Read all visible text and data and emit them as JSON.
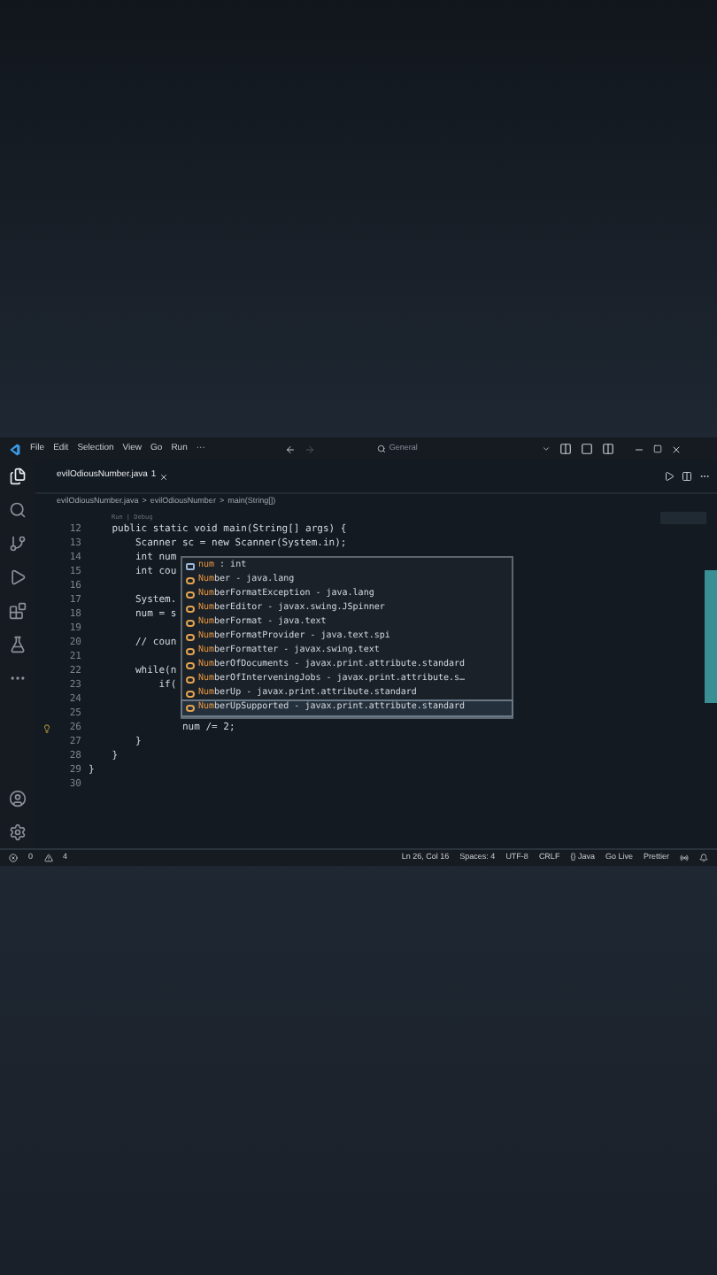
{
  "title_bar": {
    "menu": [
      "File",
      "Edit",
      "Selection",
      "View",
      "Go",
      "Run",
      "···"
    ],
    "search": {
      "placeholder": "General"
    }
  },
  "tabs": [
    {
      "label": "evilOdiousNumber.java",
      "badge": "1",
      "selected": true
    }
  ],
  "breadcrumb": [
    "evilOdiousNumber.java",
    ">",
    "evilOdiousNumber",
    ">",
    "main(String[])"
  ],
  "activity_bar": [
    {
      "kind": "files",
      "selected": true
    },
    {
      "kind": "search",
      "selected": false
    },
    {
      "kind": "source-control",
      "selected": false
    },
    {
      "kind": "run",
      "selected": false
    },
    {
      "kind": "extensions",
      "selected": false
    },
    {
      "kind": "testing",
      "selected": false
    },
    {
      "kind": "more",
      "selected": false
    }
  ],
  "code_lens": "Run | Debug",
  "code_lines": [
    {
      "number": "12",
      "text": "    public static void main(String[] args) {"
    },
    {
      "number": "13",
      "text": "        Scanner sc = new Scanner(System.in);"
    },
    {
      "number": "14",
      "text": "        int num"
    },
    {
      "number": "15",
      "text": "        int cou"
    },
    {
      "number": "16"
    },
    {
      "number": "17",
      "text": "        System."
    },
    {
      "number": "18",
      "text": "        num = s"
    },
    {
      "number": "19"
    },
    {
      "number": "20",
      "text": "        // coun"
    },
    {
      "number": "21"
    },
    {
      "number": "22",
      "text": "        while(n"
    },
    {
      "number": "23",
      "text": "            if("
    },
    {
      "number": "24"
    },
    {
      "number": "25"
    },
    {
      "number": "26",
      "text": "                num /= 2;",
      "lightbulb": true
    },
    {
      "number": "27",
      "text": "        }"
    },
    {
      "number": "28",
      "text": "    }"
    },
    {
      "number": "29",
      "text": "}"
    },
    {
      "number": "30"
    }
  ],
  "suggestions": [
    {
      "kind": "variable",
      "label": "**num** : int",
      "selected": false
    },
    {
      "kind": "class",
      "label": "**Num**ber - java.lang",
      "selected": false
    },
    {
      "kind": "class",
      "label": "**Num**berFormatException - java.lang",
      "selected": false
    },
    {
      "kind": "class",
      "label": "**Num**berEditor - javax.swing.JSpinner",
      "selected": false
    },
    {
      "kind": "class",
      "label": "**Num**berFormat - java.text",
      "selected": false
    },
    {
      "kind": "class",
      "label": "**Num**berFormatProvider - java.text.spi",
      "selected": false
    },
    {
      "kind": "class",
      "label": "**Num**berFormatter - javax.swing.text",
      "selected": false
    },
    {
      "kind": "class",
      "label": "**Num**berOfDocuments - javax.print.attribute.standard",
      "selected": false
    },
    {
      "kind": "class",
      "label": "**Num**berOfInterveningJobs - javax.print.attribute.s…",
      "selected": false
    },
    {
      "kind": "class",
      "label": "**Num**berUp - javax.print.attribute.standard",
      "selected": false
    },
    {
      "kind": "class",
      "label": "**Num**berUpSupported - javax.print.attribute.standard",
      "selected": true
    }
  ],
  "status_bar": {
    "errors": "0",
    "warnings": "4",
    "right": [
      "Ln 26, Col 16",
      "Spaces: 4",
      "UTF-8",
      "CRLF",
      "{} Java",
      "Go Live",
      "Prettier"
    ]
  }
}
